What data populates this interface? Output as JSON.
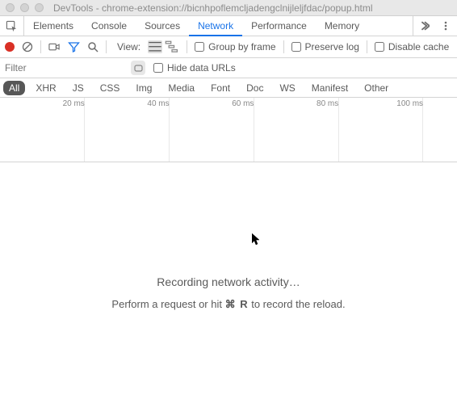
{
  "window": {
    "title": "DevTools - chrome-extension://bicnhpoflemcljadengclnijleljfdac/popup.html"
  },
  "tabs": {
    "items": [
      "Elements",
      "Console",
      "Sources",
      "Network",
      "Performance",
      "Memory"
    ],
    "active_index": 3
  },
  "toolbar": {
    "view_label": "View:",
    "group_label": "Group by frame",
    "preserve_label": "Preserve log",
    "disable_cache_label": "Disable cache"
  },
  "filterbar": {
    "placeholder": "Filter",
    "hide_label": "Hide data URLs"
  },
  "types": {
    "items": [
      "All",
      "XHR",
      "JS",
      "CSS",
      "Img",
      "Media",
      "Font",
      "Doc",
      "WS",
      "Manifest",
      "Other"
    ],
    "active_index": 0
  },
  "timeline": {
    "labels": [
      "20 ms",
      "40 ms",
      "60 ms",
      "80 ms",
      "100 ms"
    ]
  },
  "empty": {
    "line1": "Recording network activity…",
    "line2_pre": "Perform a request or hit ",
    "line2_kb": "⌘ R",
    "line2_post": " to record the reload."
  }
}
